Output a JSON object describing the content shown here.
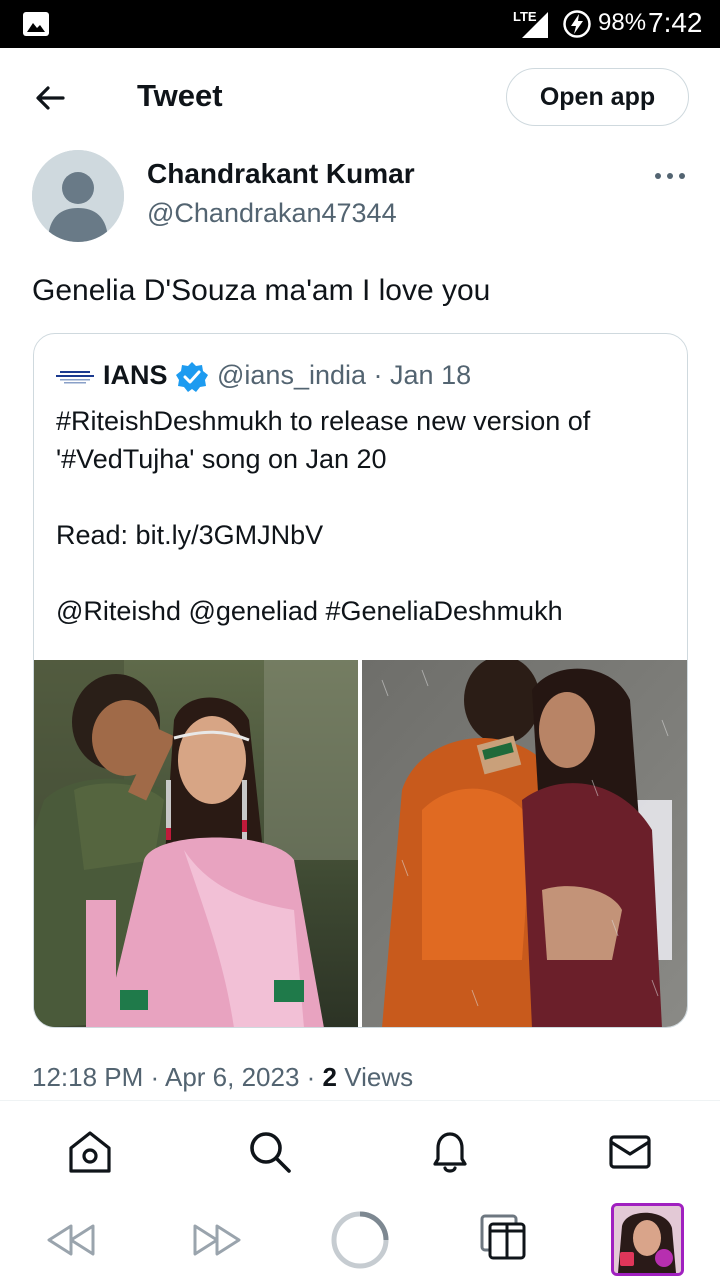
{
  "status_bar": {
    "network": "LTE",
    "battery": "98%",
    "time": "7:42",
    "icons": [
      "image-icon",
      "signal-icon",
      "charging-icon"
    ]
  },
  "header": {
    "title": "Tweet",
    "open_app_label": "Open app",
    "back_icon": "back-arrow-icon"
  },
  "tweet": {
    "author_name": "Chandrakant Kumar",
    "author_handle": "@Chandrakan47344",
    "text": "Genelia D'Souza ma'am I love you",
    "time": "12:18 PM",
    "date": "Apr 6, 2023",
    "views_count": "2",
    "views_label": "Views",
    "more_icon": "more-icon"
  },
  "quote": {
    "name": "IANS",
    "handle": "@ians_india",
    "date": "Jan 18",
    "lines": [
      "#RiteishDeshmukh to release new version of",
      "'#VedTujha' song on Jan 20",
      "",
      "Read: bit.ly/3GMJNbV",
      "",
      "@Riteishd @geneliad #GeneliaDeshmukh"
    ]
  },
  "tabbar": {
    "items": [
      "home-icon",
      "search-icon",
      "notifications-icon",
      "messages-icon"
    ]
  },
  "browser_bar": {
    "items": [
      "back-icon",
      "forward-icon",
      "reload-icon",
      "tabs-icon",
      "profile-thumbnail"
    ]
  },
  "colors": {
    "text": "#0f1419",
    "secondary": "#536471",
    "border": "#cfd9de",
    "verified": "#1d9bf0",
    "profile_border": "#a020c0"
  }
}
